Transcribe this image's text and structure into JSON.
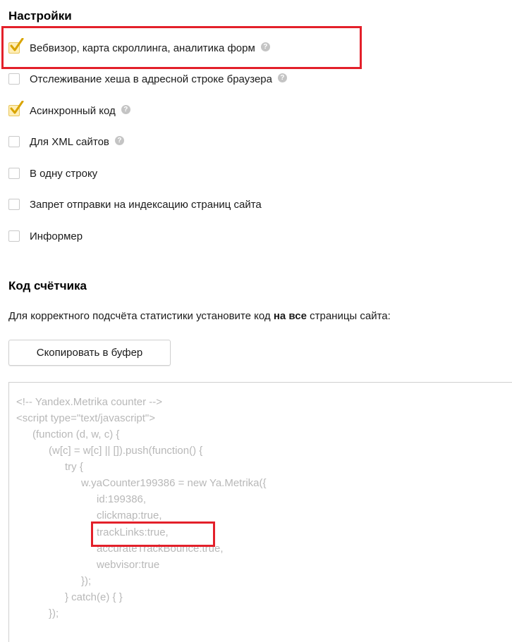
{
  "settings": {
    "title": "Настройки",
    "options": [
      {
        "label": "Вебвизор, карта скроллинга, аналитика форм",
        "checked": true,
        "help": true
      },
      {
        "label": "Отслеживание хеша в адресной строке браузера",
        "checked": false,
        "help": true
      },
      {
        "label": "Асинхронный код",
        "checked": true,
        "help": true
      },
      {
        "label": "Для XML сайтов",
        "checked": false,
        "help": true
      },
      {
        "label": "В одну строку",
        "checked": false,
        "help": false
      },
      {
        "label": "Запрет отправки на индексацию страниц сайта",
        "checked": false,
        "help": false
      },
      {
        "label": "Информер",
        "checked": false,
        "help": false
      }
    ],
    "help_glyph": "?"
  },
  "counter": {
    "title": "Код счётчика",
    "desc_before": "Для корректного подсчёта статистики установите код ",
    "desc_bold": "на все",
    "desc_after": " страницы сайта:",
    "copy_label": "Скопировать в буфер"
  },
  "code_lines": [
    "<!-- Yandex.Metrika counter -->",
    "<script type=\"text/javascript\">",
    "(function (d, w, c) {",
    "(w[c] = w[c] || []).push(function() {",
    "try {",
    "w.yaCounter199386 = new Ya.Metrika({",
    "id:199386,",
    "clickmap:true,",
    "trackLinks:true,",
    "accurateTrackBounce:true,",
    "webvisor:true",
    "});",
    "} catch(e) { }",
    "});"
  ],
  "colors": {
    "highlight": "#e3202a",
    "checkbox_checked_bg": "#ffeeb7",
    "checkmark": "#d9a400",
    "code_text": "#b8b8b8"
  }
}
